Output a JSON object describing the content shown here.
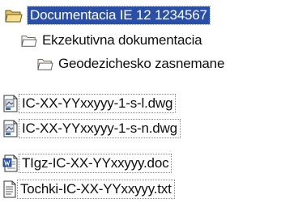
{
  "tree": {
    "folders": [
      {
        "label": "Documentacia IE 12 1234567",
        "icon": "folder-open-icon",
        "selected": true
      },
      {
        "label": "Ekzekutivna dokumentacia",
        "icon": "folder-open-icon"
      },
      {
        "label": "Geodezichesko zasnemane",
        "icon": "folder-open-icon"
      }
    ],
    "files": [
      {
        "label": "IC-XX-YYxxyyy-1-s-l.dwg",
        "icon": "dwg-file-icon"
      },
      {
        "label": "IC-XX-YYxxyyy-1-s-n.dwg",
        "icon": "dwg-file-icon"
      },
      {
        "label": "TIgz-IC-XX-YYxxyyy.doc",
        "icon": "doc-file-icon"
      },
      {
        "label": "Tochki-IC-XX-YYxxyyy.txt",
        "icon": "txt-file-icon"
      }
    ]
  },
  "colors": {
    "selection": "#2a4fa8",
    "folder": "#f3d57a"
  }
}
